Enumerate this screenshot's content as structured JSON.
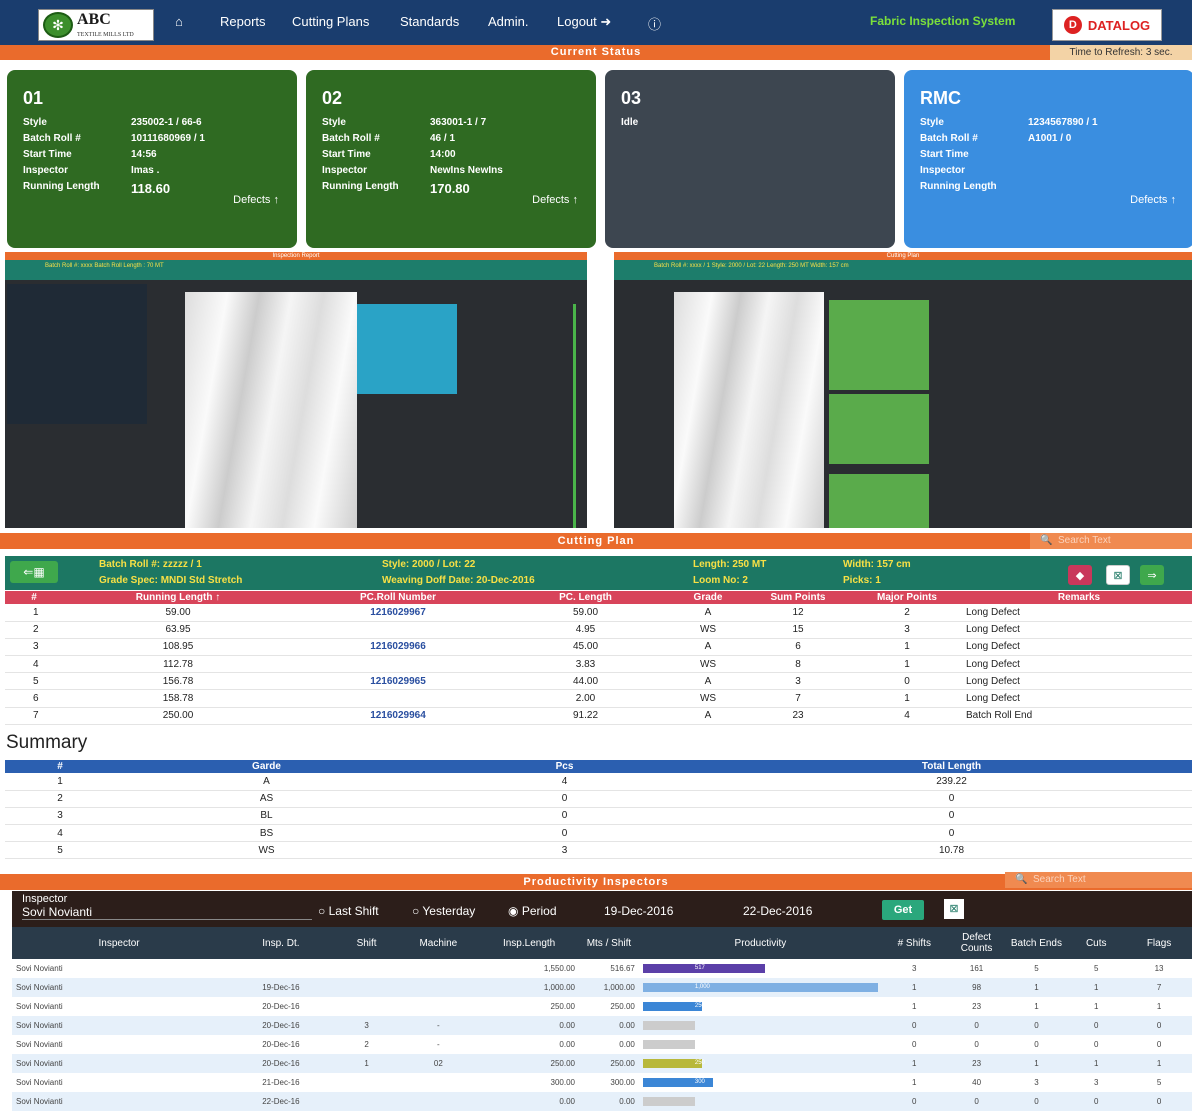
{
  "nav": {
    "logo_main": "ABC",
    "logo_sub": "TEXTILE MILLS LTD",
    "home": "⌂",
    "reports": "Reports",
    "cutting": "Cutting Plans",
    "standards": "Standards",
    "admin": "Admin.",
    "logout": "Logout ➜",
    "info": "ⓘ",
    "system": "Fabric Inspection System",
    "brand": "DATALOG"
  },
  "status": {
    "title": "Current Status",
    "refresh": "Time to Refresh: 3 sec.",
    "cards": [
      {
        "id": "01",
        "style": "235002-1 / 66-6",
        "batch": "10111680969 / 1",
        "start": "14:56",
        "inspector": "Imas .",
        "length": "118.60",
        "defects": "Defects ↑",
        "color": "#2f6a22"
      },
      {
        "id": "02",
        "style": "363001-1 / 7",
        "batch": "46 / 1",
        "start": "14:00",
        "inspector": "NewIns NewIns",
        "length": "170.80",
        "defects": "Defects ↑",
        "color": "#2f6a22"
      },
      {
        "id": "03",
        "idle": "Idle",
        "color": "#3d4650"
      },
      {
        "id": "RMC",
        "style": "1234567890 / 1",
        "batch": "A1001 / 0",
        "start": "",
        "inspector": "",
        "length": "",
        "defects": "Defects ↑",
        "color": "#3a8ee0"
      }
    ],
    "labels": {
      "style": "Style",
      "batch": "Batch Roll #",
      "start": "Start Time",
      "inspector": "Inspector",
      "length": "Running Length"
    }
  },
  "thumbs": {
    "left_title": "Inspection Report",
    "right_title": "Cutting Plan",
    "left_head": "Batch Roll #: xxxx  Batch Roll Length : 70 MT",
    "right_head": "Batch Roll #: xxxx / 1    Style: 2000 / Lot: 22    Length: 250 MT    Width: 157 cm"
  },
  "cutting": {
    "title": "Cutting Plan",
    "search": "Search Text",
    "batch": "Batch Roll #: zzzzz / 1",
    "grade": "Grade Spec: MNDI Std Stretch",
    "style": "Style: 2000 / Lot: 22",
    "doff": "Weaving Doff Date: 20-Dec-2016",
    "length": "Length: 250 MT",
    "loom": "Loom No: 2",
    "width": "Width: 157 cm",
    "picks": "Picks: 1",
    "headers": [
      "#",
      "Running Length ↑",
      "PC.Roll Number",
      "PC. Length",
      "Grade",
      "Sum Points",
      "Major Points",
      "Remarks"
    ],
    "rows": [
      [
        "1",
        "59.00",
        "1216029967",
        "59.00",
        "A",
        "12",
        "2",
        "Long Defect"
      ],
      [
        "2",
        "63.95",
        "",
        "4.95",
        "WS",
        "15",
        "3",
        "Long Defect"
      ],
      [
        "3",
        "108.95",
        "1216029966",
        "45.00",
        "A",
        "6",
        "1",
        "Long Defect"
      ],
      [
        "4",
        "112.78",
        "",
        "3.83",
        "WS",
        "8",
        "1",
        "Long Defect"
      ],
      [
        "5",
        "156.78",
        "1216029965",
        "44.00",
        "A",
        "3",
        "0",
        "Long Defect"
      ],
      [
        "6",
        "158.78",
        "",
        "2.00",
        "WS",
        "7",
        "1",
        "Long Defect"
      ],
      [
        "7",
        "250.00",
        "1216029964",
        "91.22",
        "A",
        "23",
        "4",
        "Batch Roll End"
      ]
    ]
  },
  "summary": {
    "title": "Summary",
    "headers": [
      "#",
      "Garde",
      "Pcs",
      "Total Length"
    ],
    "rows": [
      [
        "1",
        "A",
        "4",
        "239.22"
      ],
      [
        "2",
        "AS",
        "0",
        "0"
      ],
      [
        "3",
        "BL",
        "0",
        "0"
      ],
      [
        "4",
        "BS",
        "0",
        "0"
      ],
      [
        "5",
        "WS",
        "3",
        "10.78"
      ]
    ]
  },
  "productivity": {
    "title": "Productivity Inspectors",
    "search": "Search Text",
    "inspector_label": "Inspector",
    "inspector_value": "Sovi Novianti",
    "opt1": "Last Shift",
    "opt2": "Yesterday",
    "opt3": "Period",
    "date_from": "19-Dec-2016",
    "date_to": "22-Dec-2016",
    "get": "Get",
    "headers": [
      "Inspector",
      "Insp. Dt.",
      "Shift",
      "Machine",
      "Insp.Length",
      "Mts / Shift",
      "Productivity",
      "# Shifts",
      "Defect Counts",
      "Batch Ends",
      "Cuts",
      "Flags"
    ],
    "rows": [
      {
        "c": [
          "Sovi Novianti",
          "",
          "",
          "",
          "1,550.00",
          "516.67",
          "",
          "3",
          "161",
          "5",
          "5",
          "13"
        ],
        "bar": "517",
        "pct": 0.52,
        "col": "#5b3fa8"
      },
      {
        "c": [
          "Sovi Novianti",
          "19-Dec-16",
          "",
          "",
          "1,000.00",
          "1,000.00",
          "",
          "1",
          "98",
          "1",
          "1",
          "7"
        ],
        "bar": "1,000",
        "pct": 1.0,
        "col": "#7fb0e3"
      },
      {
        "c": [
          "Sovi Novianti",
          "20-Dec-16",
          "",
          "",
          "250.00",
          "250.00",
          "",
          "1",
          "23",
          "1",
          "1",
          "1"
        ],
        "bar": "250",
        "pct": 0.25,
        "col": "#3b86d6"
      },
      {
        "c": [
          "Sovi Novianti",
          "20-Dec-16",
          "3",
          "-",
          "0.00",
          "0.00",
          "",
          "0",
          "0",
          "0",
          "0",
          "0"
        ],
        "bar": "",
        "pct": 0,
        "col": "#ccc"
      },
      {
        "c": [
          "Sovi Novianti",
          "20-Dec-16",
          "2",
          "-",
          "0.00",
          "0.00",
          "",
          "0",
          "0",
          "0",
          "0",
          "0"
        ],
        "bar": "",
        "pct": 0,
        "col": "#ccc"
      },
      {
        "c": [
          "Sovi Novianti",
          "20-Dec-16",
          "1",
          "02",
          "250.00",
          "250.00",
          "",
          "1",
          "23",
          "1",
          "1",
          "1"
        ],
        "bar": "250",
        "pct": 0.25,
        "col": "#b8b83a"
      },
      {
        "c": [
          "Sovi Novianti",
          "21-Dec-16",
          "",
          "",
          "300.00",
          "300.00",
          "",
          "1",
          "40",
          "3",
          "3",
          "5"
        ],
        "bar": "300",
        "pct": 0.3,
        "col": "#3b86d6"
      },
      {
        "c": [
          "Sovi Novianti",
          "22-Dec-16",
          "",
          "",
          "0.00",
          "0.00",
          "",
          "0",
          "0",
          "0",
          "0",
          "0"
        ],
        "bar": "",
        "pct": 0,
        "col": "#ccc"
      }
    ]
  }
}
